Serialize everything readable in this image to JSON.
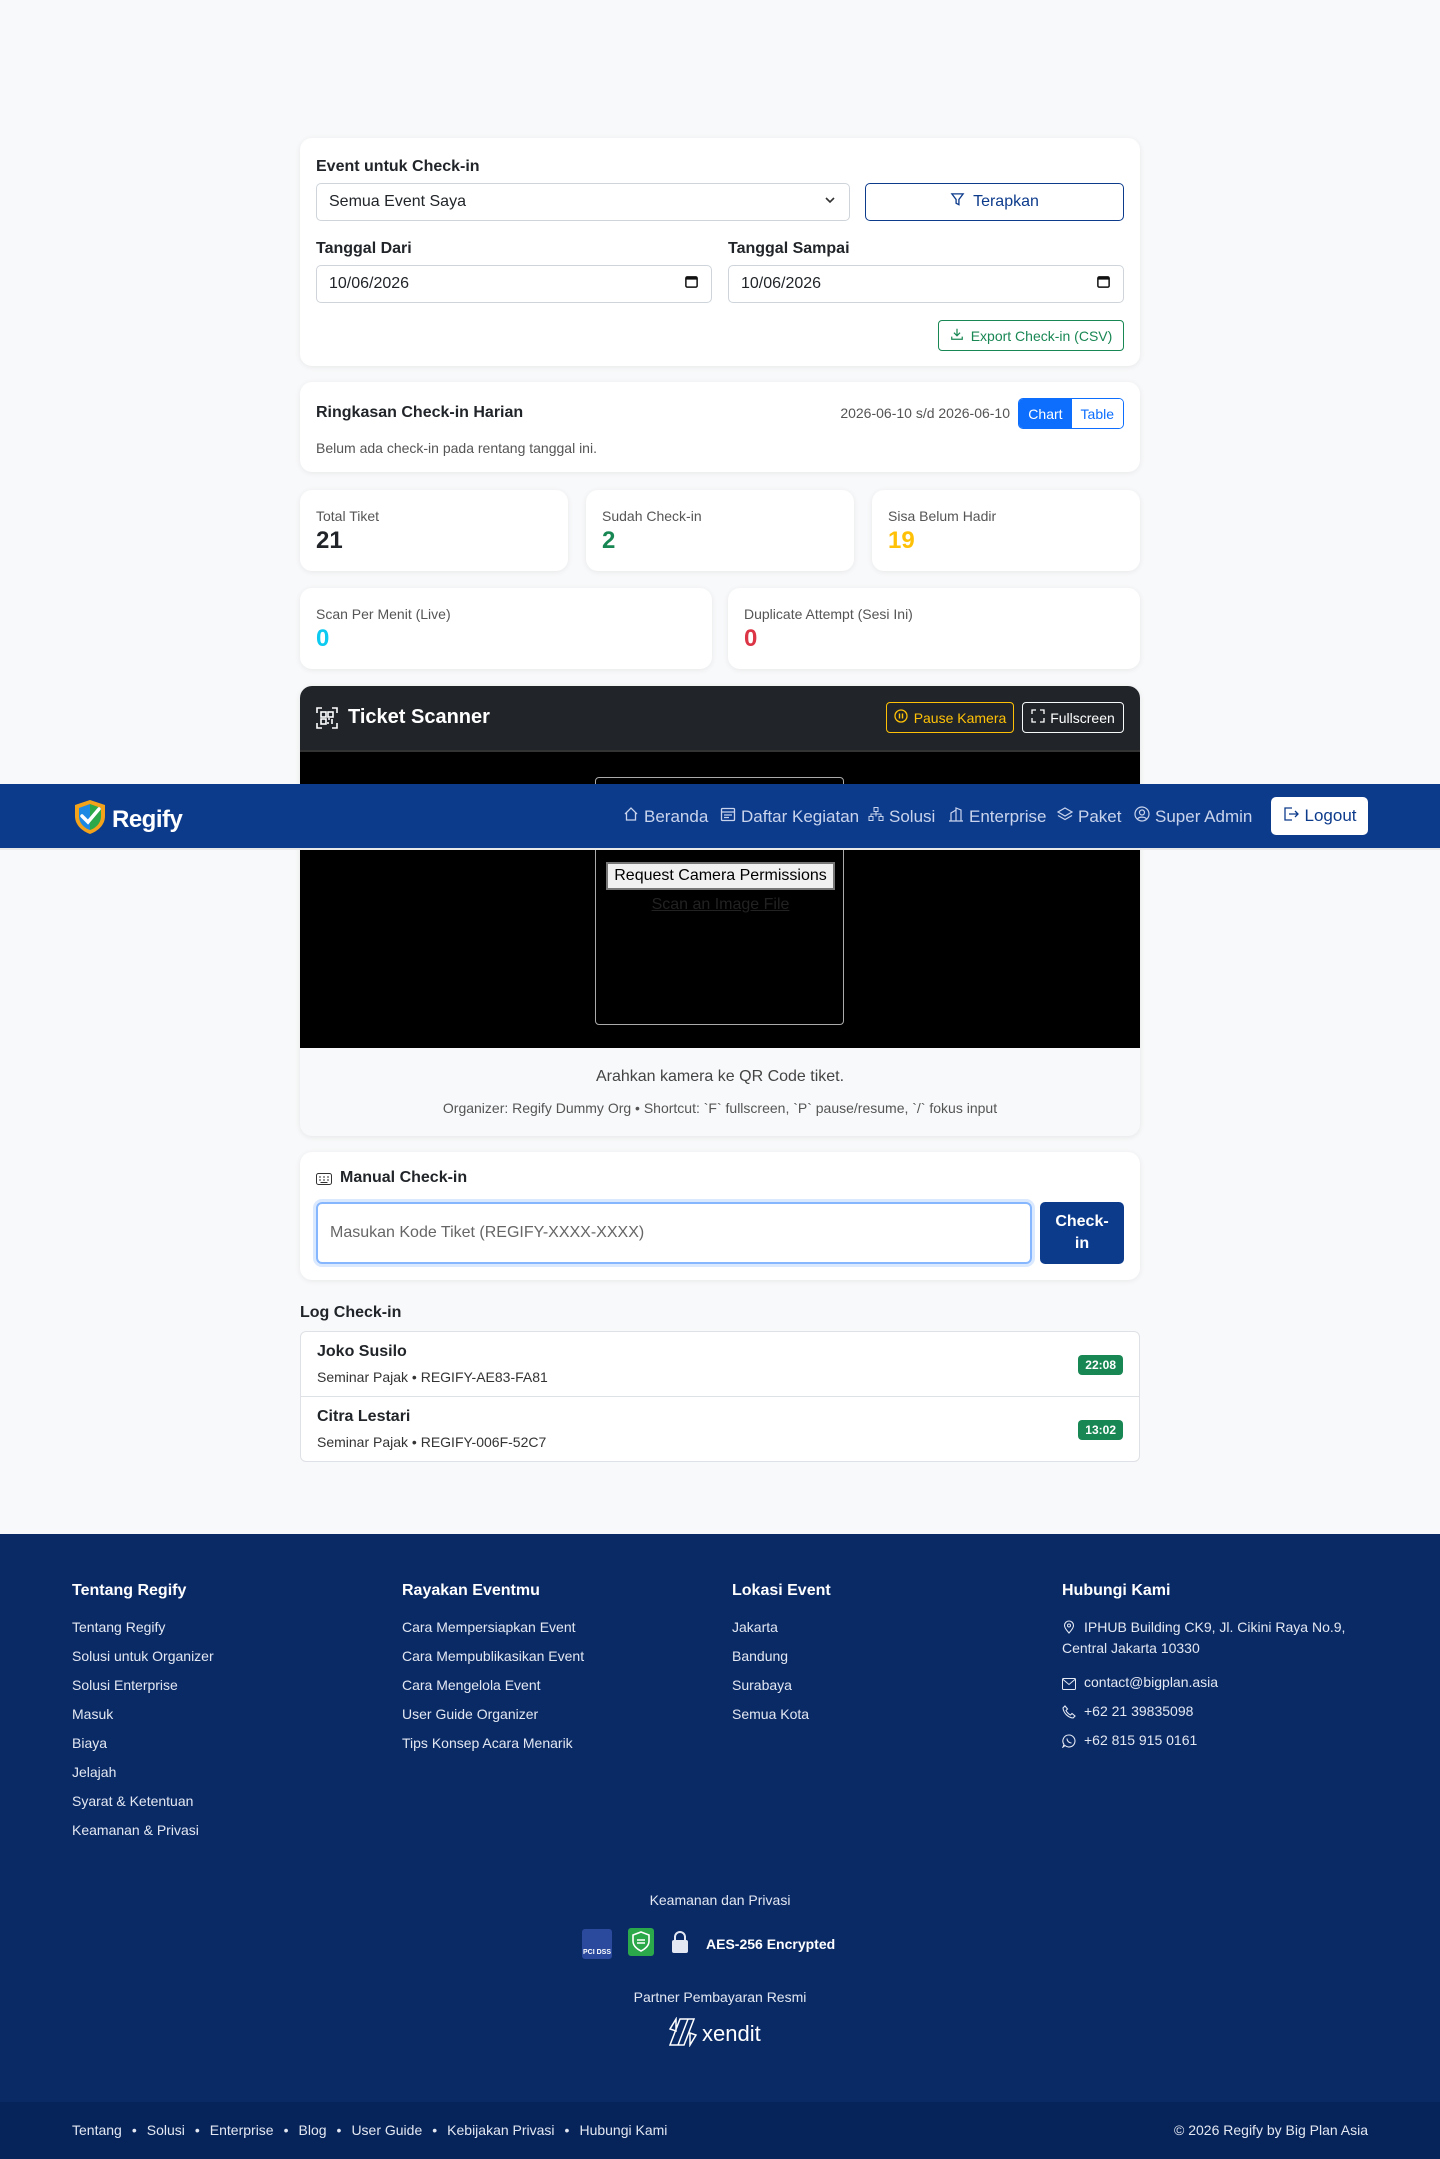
{
  "filter": {
    "event_label": "Event untuk Check-in",
    "event_value": "Semua Event Saya",
    "apply_label": "Terapkan",
    "date_from_label": "Tanggal Dari",
    "date_from_value": "10/06/2026",
    "date_to_label": "Tanggal Sampai",
    "date_to_value": "10/06/2026",
    "export_label": "Export Check-in (CSV)"
  },
  "summary": {
    "title": "Ringkasan Check-in Harian",
    "range": "2026-06-10 s/d 2026-06-10",
    "toggle_chart": "Chart",
    "toggle_table": "Table",
    "empty_text": "Belum ada check-in pada rentang tanggal ini."
  },
  "stats": {
    "total_label": "Total Tiket",
    "total_value": "21",
    "checked_label": "Sudah Check-in",
    "checked_value": "2",
    "remaining_label": "Sisa Belum Hadir",
    "remaining_value": "19",
    "spm_label": "Scan Per Menit (Live)",
    "spm_value": "0",
    "dup_label": "Duplicate Attempt (Sesi Ini)",
    "dup_value": "0"
  },
  "scanner": {
    "title": "Ticket Scanner",
    "pause_label": "Pause Kamera",
    "fullscreen_label": "Fullscreen",
    "request_permission_label": "Request Camera Permissions",
    "scan_file_label": "Scan an Image File",
    "hint": "Arahkan kamera ke QR Code tiket.",
    "meta": "Organizer: Regify Dummy Org • Shortcut: `F` fullscreen, `P` pause/resume, `/` fokus input"
  },
  "manual": {
    "title": "Manual Check-in",
    "placeholder": "Masukan Kode Tiket (REGIFY-XXXX-XXXX)",
    "button_line1": "Check-",
    "button_line2": "in"
  },
  "log": {
    "title": "Log Check-in",
    "items": [
      {
        "name": "Joko Susilo",
        "detail": "Seminar Pajak • REGIFY-AE83-FA81",
        "time": "22:08"
      },
      {
        "name": "Citra Lestari",
        "detail": "Seminar Pajak • REGIFY-006F-52C7",
        "time": "13:02"
      }
    ]
  },
  "navbar": {
    "brand": "Regify",
    "items": [
      "Beranda",
      "Daftar Kegiatan",
      "Solusi",
      "Enterprise",
      "Paket",
      "Super Admin"
    ],
    "logout_label": "Logout"
  },
  "footer": {
    "about_title": "Tentang Regify",
    "about_links": [
      "Tentang Regify",
      "Solusi untuk Organizer",
      "Solusi Enterprise",
      "Masuk",
      "Biaya",
      "Jelajah",
      "Syarat & Ketentuan",
      "Keamanan & Privasi"
    ],
    "celebrate_title": "Rayakan Eventmu",
    "celebrate_links": [
      "Cara Mempersiapkan Event",
      "Cara Mempublikasikan Event",
      "Cara Mengelola Event",
      "User Guide Organizer",
      "Tips Konsep Acara Menarik"
    ],
    "location_title": "Lokasi Event",
    "location_links": [
      "Jakarta",
      "Bandung",
      "Surabaya",
      "Semua Kota"
    ],
    "contact_title": "Hubungi Kami",
    "address_line1": "IPHUB Building CK9, Jl. Cikini Raya No.9,",
    "address_line2": "Central Jakarta 10330",
    "email": "contact@bigplan.asia",
    "phone": "+62 21 39835098",
    "whatsapp": "+62 815 915 0161",
    "security_title": "Keamanan dan Privasi",
    "pci_badge": "PCI DSS",
    "encryption": "AES-256 Encrypted",
    "partner_title": "Partner Pembayaran Resmi",
    "partner_name": "xendit",
    "bottom_links": [
      "Tentang",
      "Solusi",
      "Enterprise",
      "Blog",
      "User Guide",
      "Kebijakan Privasi",
      "Hubungi Kami"
    ],
    "copyright": "© 2026 Regify by Big Plan Asia"
  },
  "colors": {
    "primary": "#0d3b8c",
    "accent_blue": "#0d6efd",
    "success": "#198754",
    "warning": "#ffc107",
    "info": "#0dcaf0",
    "danger": "#dc3545",
    "footer_bg": "#0a2a66"
  }
}
